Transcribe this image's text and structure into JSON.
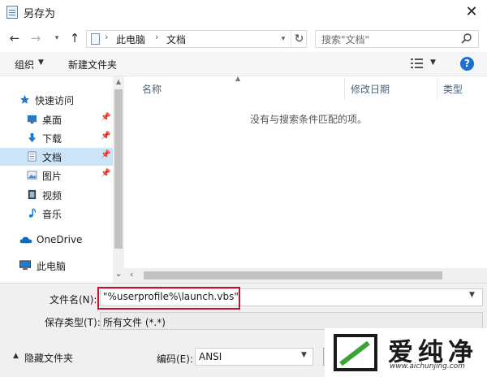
{
  "window": {
    "title": "另存为",
    "close_symbol": "✕"
  },
  "address_bar": {
    "segments": [
      "此电脑",
      "文档"
    ],
    "separator": "›"
  },
  "search": {
    "placeholder": "搜索\"文档\""
  },
  "toolbar": {
    "organize": "组织",
    "new_folder": "新建文件夹",
    "help": "?"
  },
  "sidebar": {
    "items": [
      {
        "label": "快速访问",
        "icon": "star-icon"
      },
      {
        "label": "桌面",
        "icon": "desktop-icon",
        "pinned": true
      },
      {
        "label": "下载",
        "icon": "download-arrow-icon",
        "pinned": true
      },
      {
        "label": "文档",
        "icon": "document-icon",
        "pinned": true,
        "selected": true
      },
      {
        "label": "图片",
        "icon": "pictures-icon",
        "pinned": true
      },
      {
        "label": "视频",
        "icon": "video-icon"
      },
      {
        "label": "音乐",
        "icon": "music-note-icon"
      },
      {
        "label": "OneDrive",
        "icon": "cloud-icon"
      },
      {
        "label": "此电脑",
        "icon": "computer-icon"
      }
    ]
  },
  "file_list": {
    "columns": [
      "名称",
      "修改日期",
      "类型"
    ],
    "empty_message": "没有与搜索条件匹配的项。"
  },
  "form": {
    "filename_label": "文件名(N):",
    "filename_value": "\"%userprofile%\\launch.vbs\"",
    "filetype_label": "保存类型(T):",
    "filetype_value": "所有文件  (*.*)",
    "hide_folders": "隐藏文件夹",
    "encoding_label": "编码(E):",
    "encoding_value": "ANSI"
  },
  "watermark": {
    "text": "爱纯净",
    "url": "www.aichunjing.com"
  },
  "colors": {
    "selection": "#cce4f7",
    "accent": "#1e6fd0",
    "highlight_border": "#c8102e"
  }
}
